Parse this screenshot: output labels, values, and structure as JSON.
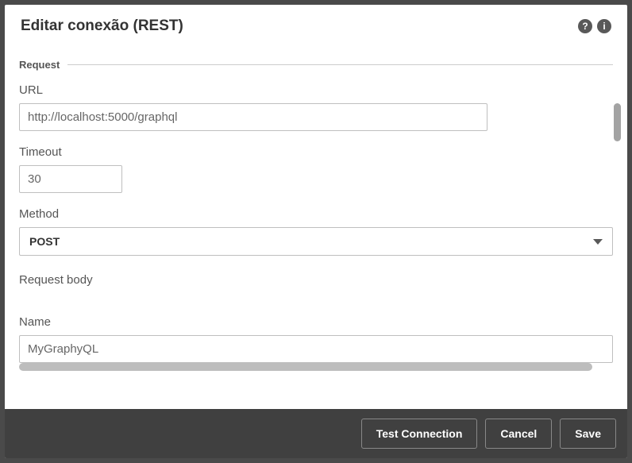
{
  "dialog": {
    "title": "Editar conexão (REST)"
  },
  "section": {
    "request": "Request"
  },
  "fields": {
    "url": {
      "label": "URL",
      "value": "http://localhost:5000/graphql"
    },
    "timeout": {
      "label": "Timeout",
      "value": "30"
    },
    "method": {
      "label": "Method",
      "value": "POST"
    },
    "requestBody": {
      "label": "Request body"
    },
    "name": {
      "label": "Name",
      "value": "MyGraphyQL"
    }
  },
  "footer": {
    "test": "Test Connection",
    "cancel": "Cancel",
    "save": "Save"
  }
}
